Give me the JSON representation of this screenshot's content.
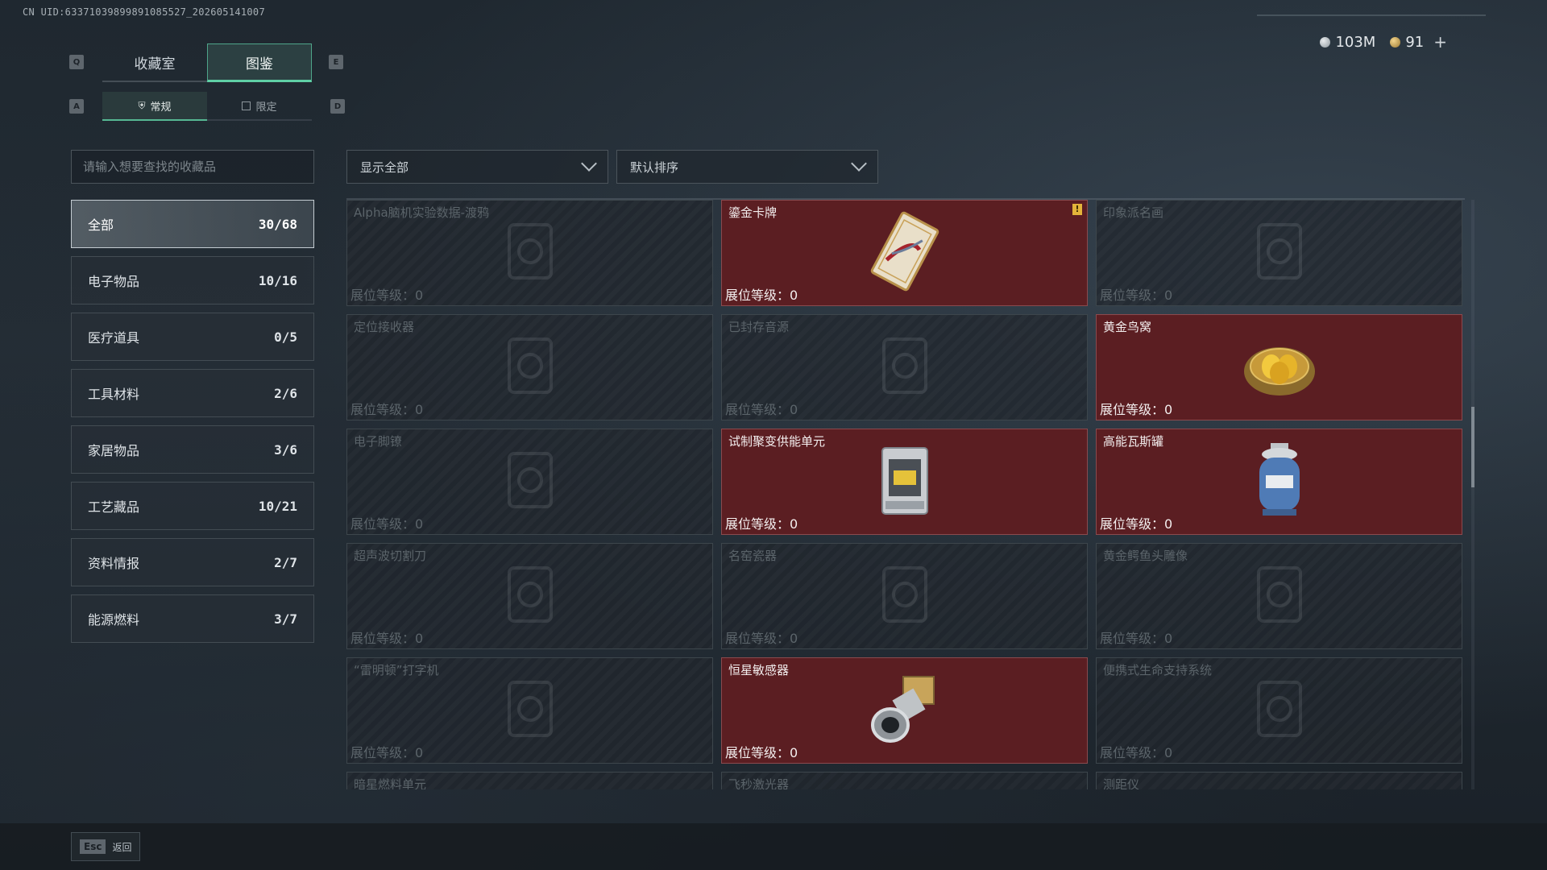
{
  "uid": "CN UID:6337103989989108552​7_202605141007",
  "currency": {
    "silver": "103M",
    "gold": "91",
    "plus": "+"
  },
  "keys": {
    "left": "Q",
    "right": "E",
    "sub_left": "A",
    "sub_right": "D"
  },
  "tabs": [
    {
      "label": "收藏室"
    },
    {
      "label": "图鉴"
    }
  ],
  "subtabs": [
    {
      "label": "常规"
    },
    {
      "label": "限定"
    }
  ],
  "search": {
    "placeholder": "请输入想要查找的收藏品"
  },
  "categories": [
    {
      "label": "全部",
      "count": "30/68"
    },
    {
      "label": "电子物品",
      "count": "10/16"
    },
    {
      "label": "医疗道具",
      "count": "0/5"
    },
    {
      "label": "工具材料",
      "count": "2/6"
    },
    {
      "label": "家居物品",
      "count": "3/6"
    },
    {
      "label": "工艺藏品",
      "count": "10/21"
    },
    {
      "label": "资料情报",
      "count": "2/7"
    },
    {
      "label": "能源燃料",
      "count": "3/7"
    }
  ],
  "filters": {
    "show": "显示全部",
    "sort": "默认排序"
  },
  "level_prefix": "展位等级：",
  "items": [
    {
      "name": "Alpha脑机实验数据-渡鸦",
      "level": "0",
      "owned": false,
      "icon": "data-drive-icon"
    },
    {
      "name": "鎏金卡牌",
      "level": "0",
      "owned": true,
      "icon": "gilded-card-icon",
      "warning": "!"
    },
    {
      "name": "印象派名画",
      "level": "0",
      "owned": false,
      "icon": "painting-frame-icon"
    },
    {
      "name": "定位接收器",
      "level": "0",
      "owned": false,
      "icon": "receiver-icon"
    },
    {
      "name": "已封存音源",
      "level": "0",
      "owned": false,
      "icon": "audio-source-icon"
    },
    {
      "name": "黄金鸟窝",
      "level": "0",
      "owned": true,
      "icon": "golden-nest-icon"
    },
    {
      "name": "电子脚镣",
      "level": "0",
      "owned": false,
      "icon": "shackle-icon"
    },
    {
      "name": "试制聚变供能单元",
      "level": "0",
      "owned": true,
      "icon": "fusion-unit-icon"
    },
    {
      "name": "高能瓦斯罐",
      "level": "0",
      "owned": true,
      "icon": "gas-canister-icon"
    },
    {
      "name": "超声波切割刀",
      "level": "0",
      "owned": false,
      "icon": "cutter-icon"
    },
    {
      "name": "名窑瓷器",
      "level": "0",
      "owned": false,
      "icon": "porcelain-vase-icon"
    },
    {
      "name": "黄金鳄鱼头雕像",
      "level": "0",
      "owned": false,
      "icon": "crocodile-statue-icon"
    },
    {
      "name": "“雷明顿”打字机",
      "level": "0",
      "owned": false,
      "icon": "typewriter-icon"
    },
    {
      "name": "恒星敏感器",
      "level": "0",
      "owned": true,
      "icon": "star-sensor-icon"
    },
    {
      "name": "便携式生命支持系统",
      "level": "0",
      "owned": false,
      "icon": "life-support-icon"
    },
    {
      "name": "暗星燃料单元",
      "level": "",
      "owned": false,
      "icon": "fuel-cell-icon"
    },
    {
      "name": "飞秒激光器",
      "level": "",
      "owned": false,
      "icon": "laser-icon"
    },
    {
      "name": "测距仪",
      "level": "",
      "owned": false,
      "icon": "rangefinder-icon"
    }
  ],
  "footer": {
    "key": "Esc",
    "label": "返回"
  }
}
